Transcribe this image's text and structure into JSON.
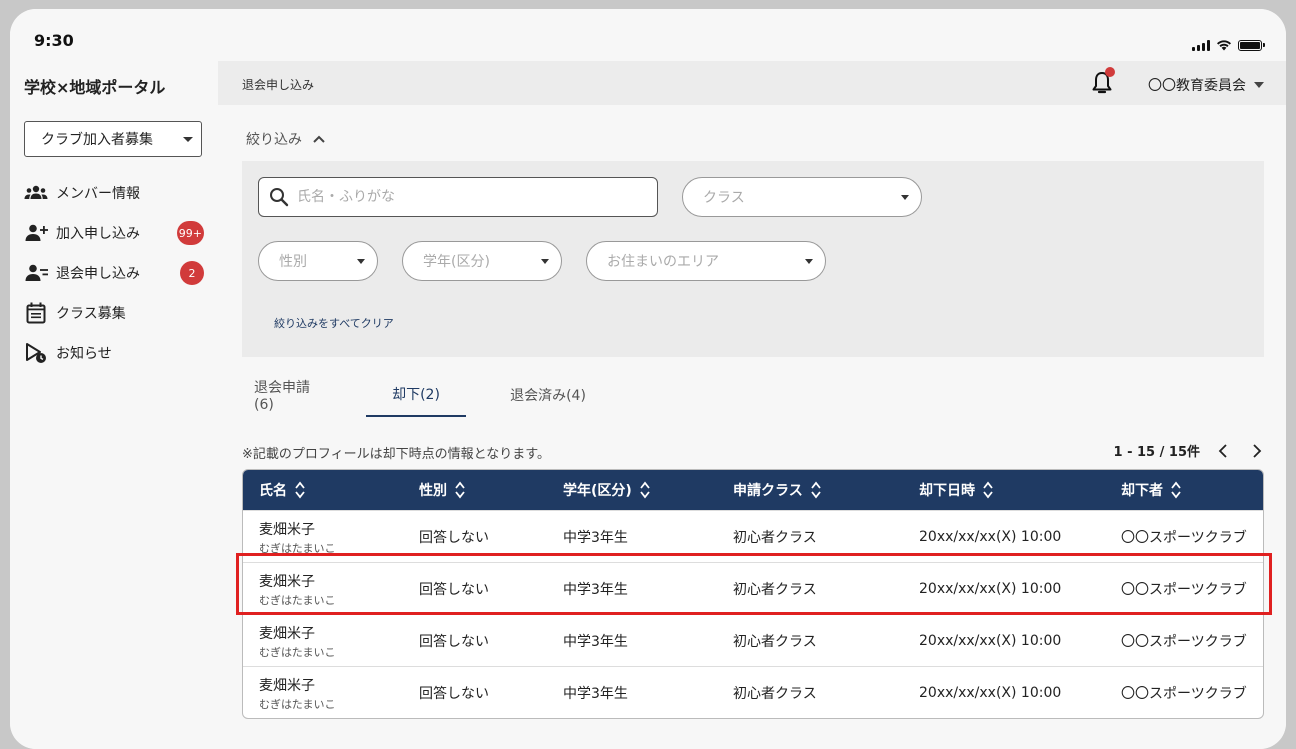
{
  "status": {
    "time": "9:30"
  },
  "sidebar": {
    "app_title": "学校×地域ポータル",
    "club_select": "クラブ加入者募集",
    "items": [
      {
        "label": "メンバー情報",
        "icon": "group-icon",
        "badge": ""
      },
      {
        "label": "加入申し込み",
        "icon": "person-add-icon",
        "badge": "99+"
      },
      {
        "label": "退会申し込み",
        "icon": "person-remove-icon",
        "badge": "2"
      },
      {
        "label": "クラス募集",
        "icon": "calendar-list-icon",
        "badge": ""
      },
      {
        "label": "お知らせ",
        "icon": "megaphone-clock-icon",
        "badge": ""
      }
    ]
  },
  "header": {
    "breadcrumb": "退会申し込み",
    "account": "〇〇教育委員会"
  },
  "filter": {
    "toggle_label": "絞り込み",
    "search_placeholder": "氏名・ふりがな",
    "class_placeholder": "クラス",
    "gender_placeholder": "性別",
    "grade_placeholder": "学年(区分)",
    "area_placeholder": "お住まいのエリア",
    "clear_label": "絞り込みをすべてクリア"
  },
  "tabs": [
    {
      "label": "退会申請(6)",
      "active": false
    },
    {
      "label": "却下(2)",
      "active": true
    },
    {
      "label": "退会済み(4)",
      "active": false
    }
  ],
  "note": "※記載のプロフィールは却下時点の情報となります。",
  "pager": {
    "label": "1 - 15 / 15件"
  },
  "table": {
    "columns": [
      "氏名",
      "性別",
      "学年(区分)",
      "申請クラス",
      "却下日時",
      "却下者"
    ],
    "rows": [
      {
        "name": "麦畑米子",
        "kana": "むぎはたまいこ",
        "gender": "回答しない",
        "grade": "中学3年生",
        "class": "初心者クラス",
        "date": "20xx/xx/xx(X) 10:00",
        "by": "〇〇スポーツクラブ"
      },
      {
        "name": "麦畑米子",
        "kana": "むぎはたまいこ",
        "gender": "回答しない",
        "grade": "中学3年生",
        "class": "初心者クラス",
        "date": "20xx/xx/xx(X) 10:00",
        "by": "〇〇スポーツクラブ"
      },
      {
        "name": "麦畑米子",
        "kana": "むぎはたまいこ",
        "gender": "回答しない",
        "grade": "中学3年生",
        "class": "初心者クラス",
        "date": "20xx/xx/xx(X) 10:00",
        "by": "〇〇スポーツクラブ"
      },
      {
        "name": "麦畑米子",
        "kana": "むぎはたまいこ",
        "gender": "回答しない",
        "grade": "中学3年生",
        "class": "初心者クラス",
        "date": "20xx/xx/xx(X) 10:00",
        "by": "〇〇スポーツクラブ"
      }
    ]
  },
  "colors": {
    "primary": "#1f3a63",
    "badge": "#d13b3b",
    "highlight": "#e02020"
  }
}
